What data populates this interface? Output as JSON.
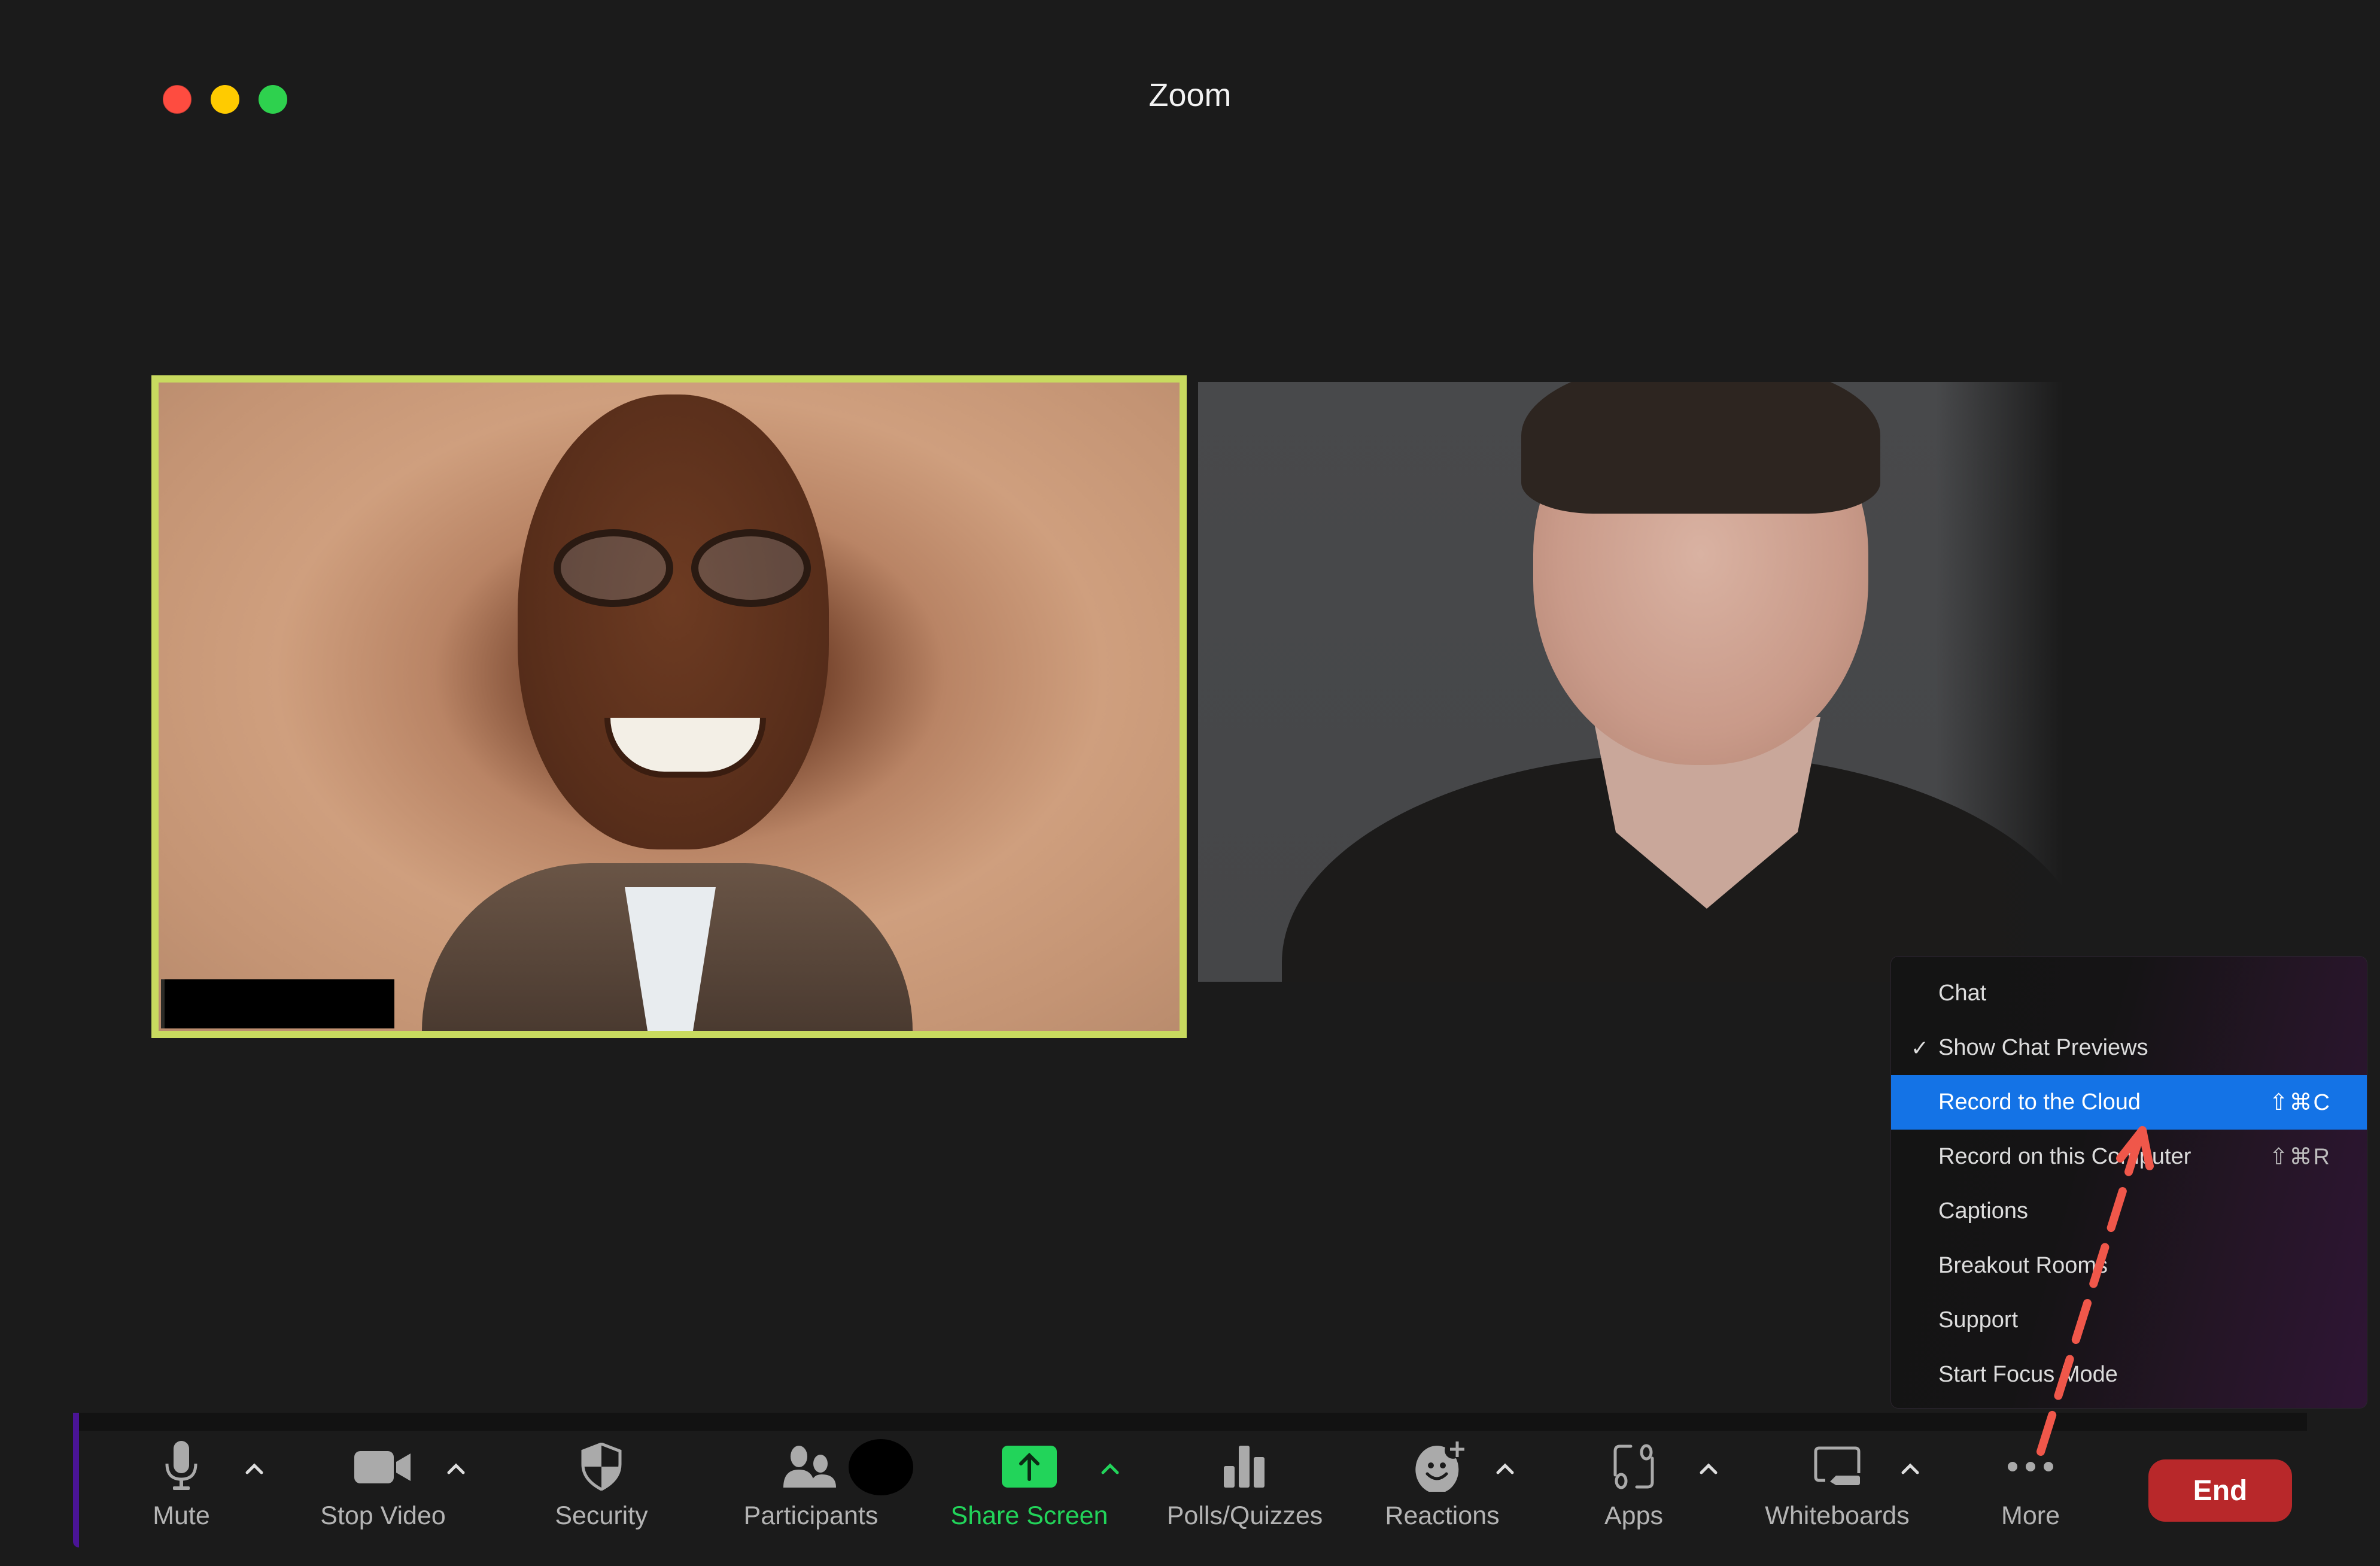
{
  "window": {
    "title": "Zoom",
    "controls": [
      "close",
      "minimize",
      "maximize"
    ],
    "control_colors": {
      "close": "#fe4c40",
      "minimize": "#ffcb00",
      "maximize": "#2ed14e"
    }
  },
  "video": {
    "active_speaker_border_color": "#c8da5f",
    "tiles": [
      {
        "participant": "smiling man with glasses",
        "active_speaker": true,
        "name_label_redacted": true
      },
      {
        "participant": "woman with short hair",
        "active_speaker": false
      }
    ]
  },
  "more_menu": {
    "highlight_color": "#1473e6",
    "items": [
      {
        "label": "Chat",
        "checked": false,
        "shortcut": ""
      },
      {
        "label": "Show Chat Previews",
        "checked": true,
        "shortcut": ""
      },
      {
        "label": "Record to the Cloud",
        "checked": false,
        "shortcut": "⇧⌘C",
        "highlighted": true
      },
      {
        "label": "Record on this Computer",
        "checked": false,
        "shortcut": "⇧⌘R"
      },
      {
        "label": "Captions",
        "checked": false,
        "shortcut": ""
      },
      {
        "label": "Breakout Rooms",
        "checked": false,
        "shortcut": ""
      },
      {
        "label": "Support",
        "checked": false,
        "shortcut": ""
      },
      {
        "label": "Start Focus Mode",
        "checked": false,
        "shortcut": ""
      }
    ],
    "check_glyph": "✓"
  },
  "toolbar": {
    "items": [
      {
        "id": "mute",
        "label": "Mute",
        "icon": "microphone-icon",
        "has_caret": true
      },
      {
        "id": "stop-video",
        "label": "Stop Video",
        "icon": "video-camera-icon",
        "has_caret": true
      },
      {
        "id": "security",
        "label": "Security",
        "icon": "shield-icon",
        "has_caret": false
      },
      {
        "id": "participants",
        "label": "Participants",
        "icon": "participants-icon",
        "has_caret": false
      },
      {
        "id": "share-screen",
        "label": "Share Screen",
        "icon": "share-screen-icon",
        "has_caret": true,
        "accent": "#22d45a"
      },
      {
        "id": "polls",
        "label": "Polls/Quizzes",
        "icon": "bar-chart-icon",
        "has_caret": false
      },
      {
        "id": "reactions",
        "label": "Reactions",
        "icon": "add-reaction-icon",
        "has_caret": true
      },
      {
        "id": "apps",
        "label": "Apps",
        "icon": "apps-icon",
        "has_caret": true
      },
      {
        "id": "whiteboards",
        "label": "Whiteboards",
        "icon": "whiteboard-icon",
        "has_caret": true
      },
      {
        "id": "more",
        "label": "More",
        "icon": "more-dots-icon",
        "has_caret": false
      }
    ],
    "end_label": "End",
    "end_color": "#b8282a",
    "caret_glyph": "^"
  },
  "annotation": {
    "type": "dashed-arrow",
    "color": "#f0574a",
    "from": "More button",
    "to": "Record to the Cloud"
  }
}
